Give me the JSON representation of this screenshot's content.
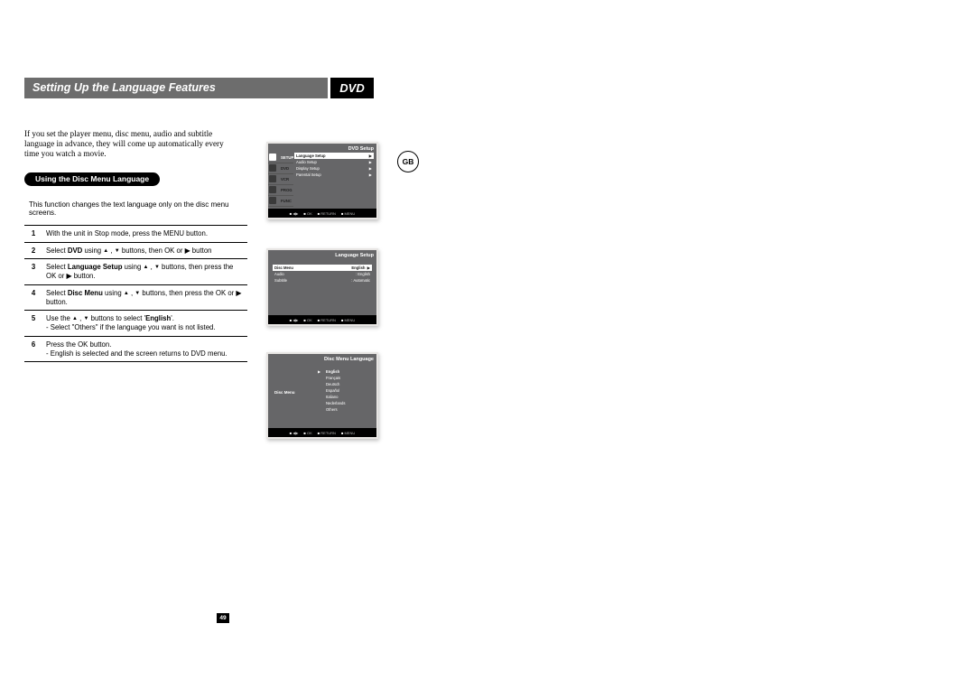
{
  "header": {
    "title": "Setting Up the Language Features",
    "badge": "DVD"
  },
  "region_badge": "GB",
  "intro": "If you set the player menu, disc menu, audio and subtitle language in advance, they will come up automatically every time you watch a movie.",
  "subheading": "Using the Disc Menu Language",
  "description": "This function changes the text language only on the disc menu screens.",
  "steps": [
    {
      "n": "1",
      "pre": "With the unit in Stop mode, press the MENU button.",
      "post": ""
    },
    {
      "n": "2",
      "pre": "Select ",
      "bold": "DVD",
      "mid": " using ",
      "icons": "ud",
      "post": " buttons, then OK or ▶ button"
    },
    {
      "n": "3",
      "pre": "Select ",
      "bold": "Language Setup",
      "mid": " using ",
      "icons": "ud",
      "post": " buttons, then press the OK or ▶ button."
    },
    {
      "n": "4",
      "pre": "Select ",
      "bold": "Disc Menu",
      "mid": " using ",
      "icons": "ud",
      "post": " buttons, then press the  OK or ▶ button."
    },
    {
      "n": "5",
      "pre": "Use the ",
      "icons": "ud",
      "mid2": " buttons to select '",
      "bold2": "English",
      "post2": "'.",
      "note": "- Select \"Others\" if the language you want is not listed."
    },
    {
      "n": "6",
      "pre": "Press the OK button.",
      "note": "- English is selected and the screen returns to DVD menu."
    }
  ],
  "osd1": {
    "title": "DVD Setup",
    "tabs": [
      "SETUP",
      "DVD",
      "VCR",
      "PROG",
      "FUNC"
    ],
    "selected_tab": 0,
    "items": [
      "Language Setup",
      "Audio Setup",
      "Display Setup",
      "Parental Setup"
    ],
    "selected_item": 0,
    "bottom": [
      "◀▶",
      "OK",
      "RETURN",
      "MENU"
    ]
  },
  "osd2": {
    "title": "Language Setup",
    "rows": [
      {
        "l": "Disc Menu",
        "r": "English",
        "sel": true
      },
      {
        "l": "Audio",
        "r": ": English",
        "sel": false
      },
      {
        "l": "Subtitle",
        "r": ": Automatic",
        "sel": false
      }
    ],
    "bottom": [
      "◀▶",
      "OK",
      "RETURN",
      "MENU"
    ]
  },
  "osd3": {
    "title": "Disc Menu Language",
    "left_label": "Disc Menu",
    "langs": [
      "English",
      "Français",
      "Deutsch",
      "Español",
      "Italiano",
      "Nederlands",
      "Others"
    ],
    "selected": 0,
    "bottom": [
      "◀▶",
      "OK",
      "RETURN",
      "MENU"
    ]
  },
  "page_number": "49"
}
